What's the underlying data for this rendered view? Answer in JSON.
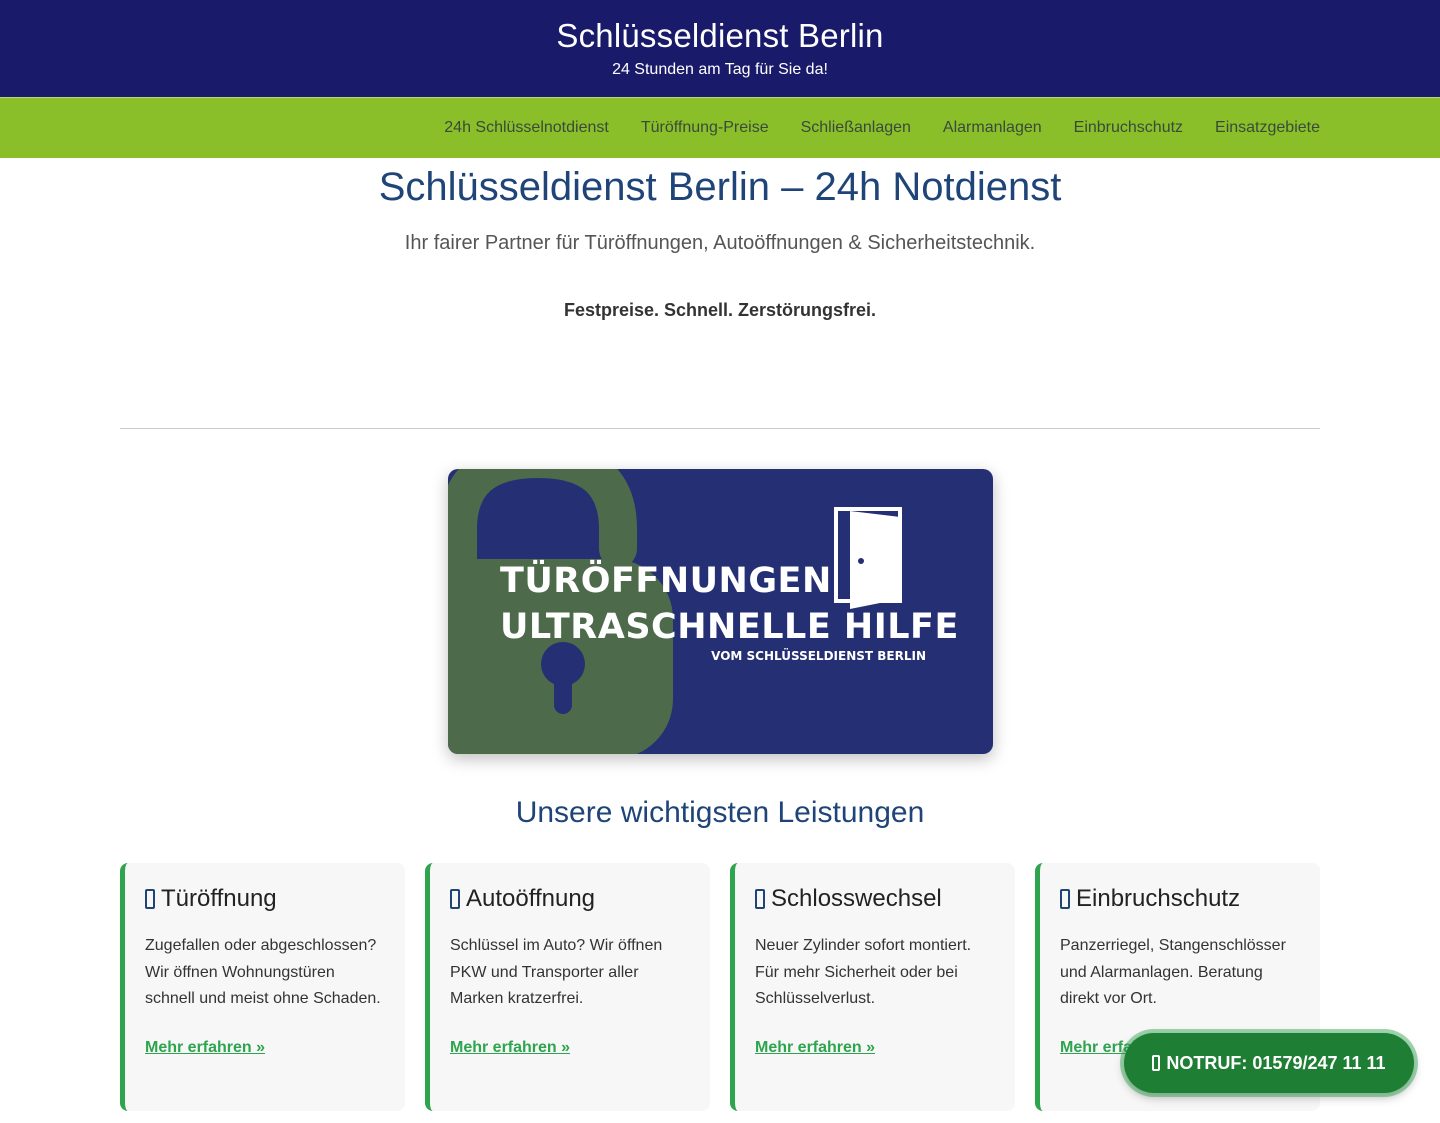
{
  "header": {
    "title": "Schlüsseldienst Berlin",
    "tagline": "24 Stunden am Tag für Sie da!"
  },
  "nav": {
    "items": [
      {
        "label": "24h Schlüsselnotdienst"
      },
      {
        "label": "Türöffnung-Preise"
      },
      {
        "label": "Schließanlagen"
      },
      {
        "label": "Alarmanlagen"
      },
      {
        "label": "Einbruchschutz"
      },
      {
        "label": "Einsatzgebiete"
      }
    ]
  },
  "hero": {
    "title": "Schlüsseldienst Berlin – 24h Notdienst",
    "subtitle": "Ihr fairer Partner für Türöffnungen, Autoöffnungen & Sicherheitstechnik.",
    "claim": "Festpreise. Schnell. Zerstörungsfrei."
  },
  "banner": {
    "line1": "TÜRÖFFNUNGEN",
    "line2": "ULTRASCHNELLE HILFE",
    "line3": "VOM SCHLÜSSELDIENST BERLIN",
    "icons": [
      "open-padlock-icon",
      "open-door-icon"
    ],
    "colors": {
      "background": "#252f74",
      "padlock": "#4d6b4a"
    }
  },
  "services": {
    "heading": "Unsere wichtigsten Leistungen",
    "cards": [
      {
        "title": "Türöffnung",
        "text": "Zugefallen oder abgeschlossen? Wir öffnen Wohnungstüren schnell und meist ohne Schaden.",
        "link": "Mehr erfahren »"
      },
      {
        "title": "Autoöffnung",
        "text": "Schlüssel im Auto? Wir öffnen PKW und Transporter aller Marken kratzerfrei.",
        "link": "Mehr erfahren »"
      },
      {
        "title": "Schlosswechsel",
        "text": "Neuer Zylinder sofort montiert. Für mehr Sicherheit oder bei Schlüsselverlust.",
        "link": "Mehr erfahren »"
      },
      {
        "title": "Einbruchschutz",
        "text": "Panzerriegel, Stangenschlösser und Alarmanlagen. Beratung direkt vor Ort.",
        "link": "Mehr erfahren »"
      }
    ]
  },
  "emergency": {
    "label": "NOTRUF: 01579/247 11 11",
    "icon": "phone-icon"
  },
  "colors": {
    "header_bg": "#1a1a6b",
    "nav_bg": "#8abf2a",
    "heading": "#1f4478",
    "accent_green": "#2ea44f",
    "button_bg": "#1e7e34"
  }
}
